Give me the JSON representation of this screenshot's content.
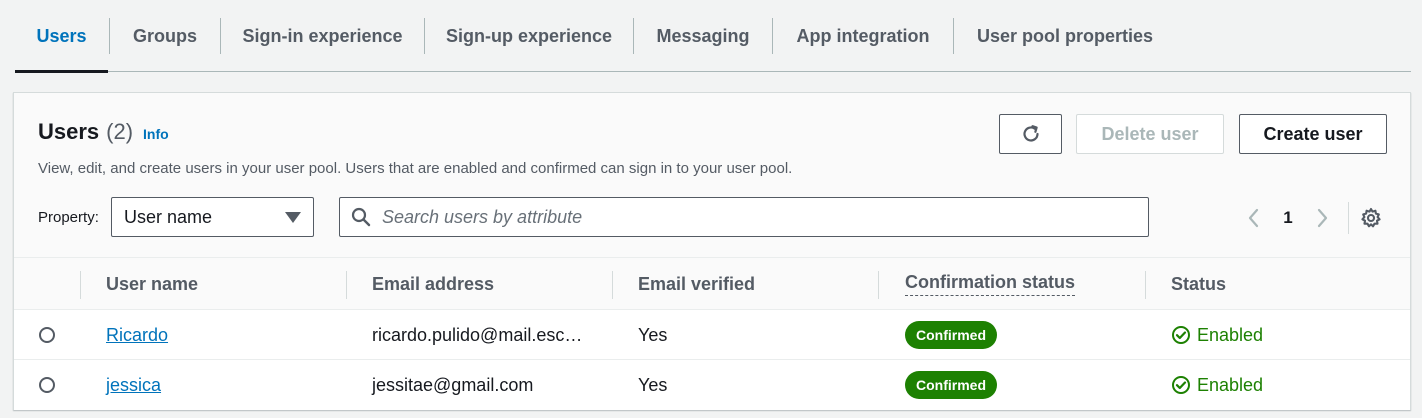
{
  "tabs": [
    {
      "label": "Users",
      "active": true
    },
    {
      "label": "Groups"
    },
    {
      "label": "Sign-in experience"
    },
    {
      "label": "Sign-up experience"
    },
    {
      "label": "Messaging"
    },
    {
      "label": "App integration"
    },
    {
      "label": "User pool properties"
    }
  ],
  "panel": {
    "title": "Users",
    "count": "(2)",
    "info": "Info",
    "description": "View, edit, and create users in your user pool. Users that are enabled and confirmed can sign in to your user pool.",
    "buttons": {
      "refresh_icon": "refresh-icon",
      "delete": "Delete user",
      "create": "Create user"
    },
    "filter": {
      "property_label": "Property:",
      "property_value": "User name",
      "search_placeholder": "Search users by attribute"
    },
    "pagination": {
      "page": "1"
    }
  },
  "table": {
    "columns": [
      "User name",
      "Email address",
      "Email verified",
      "Confirmation status",
      "Status"
    ],
    "rows": [
      {
        "user_name": "Ricardo",
        "email": "ricardo.pulido@mail.esc…",
        "email_verified": "Yes",
        "confirmation": "Confirmed",
        "status": "Enabled"
      },
      {
        "user_name": "jessica",
        "email": "jessitae@gmail.com",
        "email_verified": "Yes",
        "confirmation": "Confirmed",
        "status": "Enabled"
      }
    ]
  },
  "colors": {
    "accent": "#0073bb",
    "success": "#1d8102",
    "text": "#16191f",
    "muted": "#545b64"
  }
}
